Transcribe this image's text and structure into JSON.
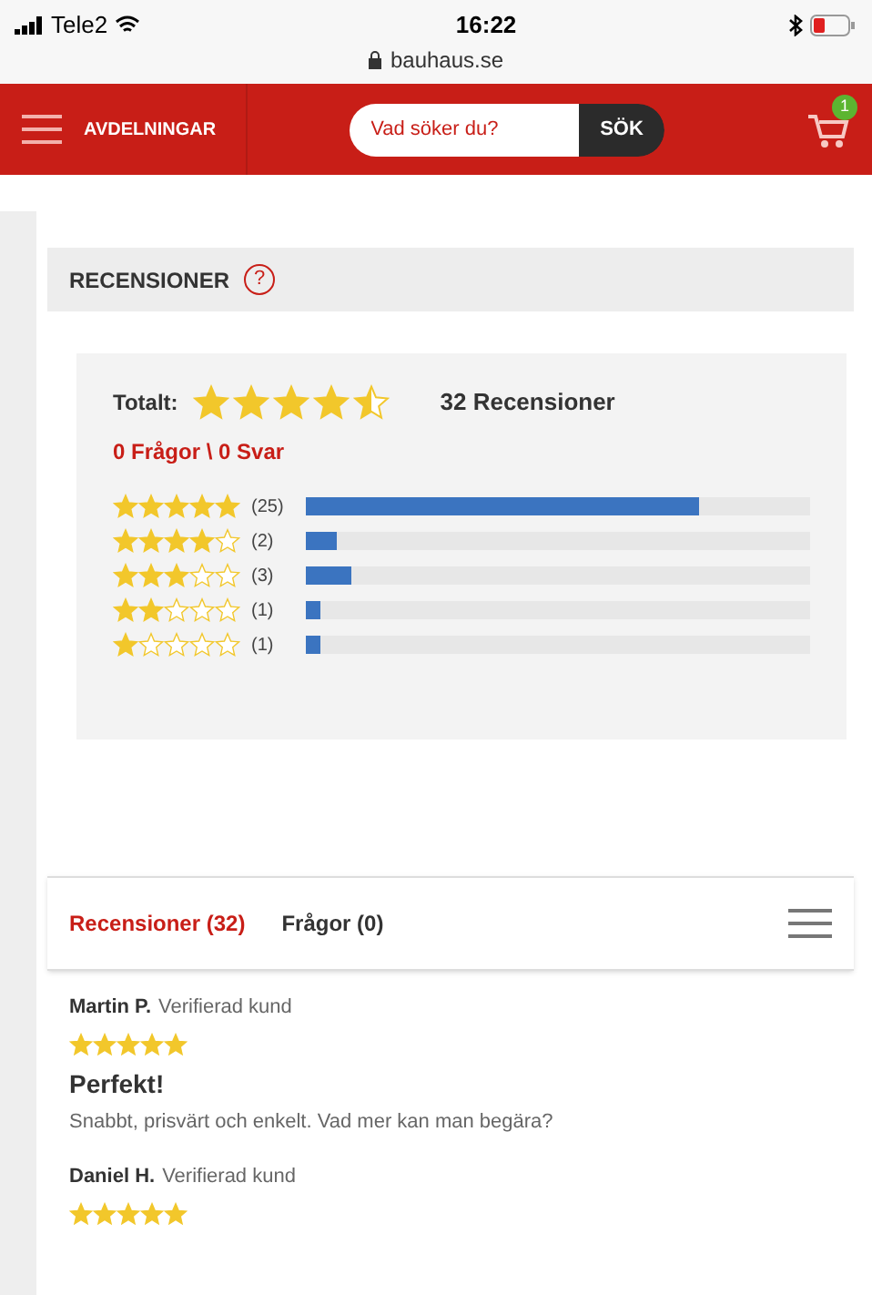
{
  "status_bar": {
    "carrier": "Tele2",
    "time": "16:22",
    "url": "bauhaus.se"
  },
  "header": {
    "menu_label": "AVDELNINGAR",
    "search": {
      "placeholder": "Vad söker du?"
    },
    "search_button": "SÖK",
    "cart_count": "1"
  },
  "section": {
    "title": "RECENSIONER",
    "help": "?"
  },
  "summary": {
    "total_label": "Totalt:",
    "stars": 4.5,
    "count": "32 Recensioner",
    "questions": "0 Frågor \\ 0 Svar",
    "distribution": [
      {
        "stars": 5,
        "count": "(25)",
        "level": 0.78
      },
      {
        "stars": 4,
        "count": "(2)",
        "level": 0.06
      },
      {
        "stars": 3,
        "count": "(3)",
        "level": 0.09
      },
      {
        "stars": 2,
        "count": "(1)",
        "level": 0.03
      },
      {
        "stars": 1,
        "count": "(1)",
        "level": 0.03
      }
    ]
  },
  "tabs": [
    {
      "label": "Recensioner (32)",
      "selected": true
    },
    {
      "label": "Frågor (0)",
      "selected": false
    }
  ],
  "reviews": [
    {
      "author": "Martin P.",
      "badge": "Verifierad kund",
      "stars": 5,
      "title": "Perfekt!",
      "text": "Snabbt, prisvärt och enkelt. Vad mer kan man begära?"
    },
    {
      "author": "Daniel H.",
      "badge": "Verifierad kund",
      "stars": 5
    }
  ]
}
